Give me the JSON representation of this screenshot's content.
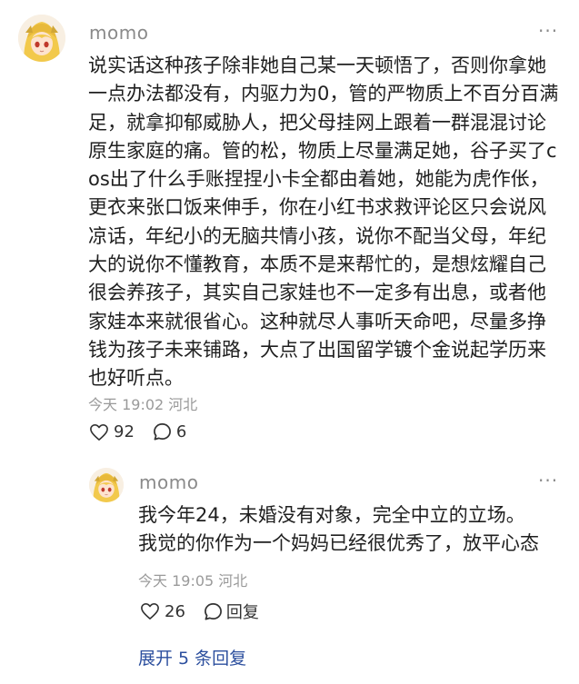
{
  "comment": {
    "username": "momo",
    "more_label": "···",
    "text": "说实话这种孩子除非她自己某一天顿悟了，否则你拿她一点办法都没有，内驱力为0，管的严物质上不百分百满足，就拿抑郁威胁人，把父母挂网上跟着一群混混讨论原生家庭的痛。管的松，物质上尽量满足她，谷子买了cos出了什么手账捏捏小卡全都由着她，她能为虎作伥，更衣来张口饭来伸手，你在小红书求救评论区只会说风凉话，年纪小的无脑共情小孩，说你不配当父母，年纪大的说你不懂教育，本质不是来帮忙的，是想炫耀自己很会养孩子，其实自己家娃也不一定多有出息，或者他家娃本来就很省心。这种就尽人事听天命吧，尽量多挣钱为孩子未来铺路，大点了出国留学镀个金说起学历来也好听点。",
    "meta": "今天 19:02 河北",
    "likes": "92",
    "replies": "6"
  },
  "reply": {
    "username": "momo",
    "more_label": "···",
    "text": "我今年24，未婚没有对象，完全中立的立场。我觉的你作为一个妈妈已经很优秀了，放平心态",
    "meta": "今天 19:05 河北",
    "likes": "26",
    "reply_label": "回复"
  },
  "expand_label": "展开 5 条回复"
}
